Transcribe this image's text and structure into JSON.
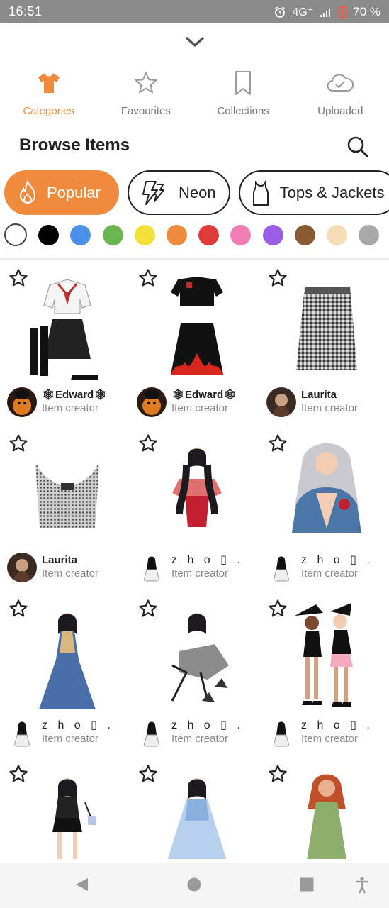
{
  "status": {
    "time": "16:51",
    "network": "4G⁺",
    "battery": "70 %"
  },
  "tabs": [
    {
      "label": "Categories",
      "icon": "tshirt-icon",
      "active": true
    },
    {
      "label": "Favourites",
      "icon": "star-icon",
      "active": false
    },
    {
      "label": "Collections",
      "icon": "bookmark-icon",
      "active": false
    },
    {
      "label": "Uploaded",
      "icon": "cloud-check-icon",
      "active": false
    }
  ],
  "browse": {
    "title": "Browse Items"
  },
  "chips": [
    {
      "label": "Popular",
      "icon": "fire-icon",
      "active": true
    },
    {
      "label": "Neon",
      "icon": "lightning-icon",
      "active": false
    },
    {
      "label": "Tops & Jackets",
      "icon": "tank-top-icon",
      "active": false
    }
  ],
  "colors": [
    "#ffffff",
    "#000000",
    "#4a8fe8",
    "#6ab550",
    "#f3e13a",
    "#f08a3c",
    "#e03c3c",
    "#f07eb4",
    "#9b5de5",
    "#8a5a32",
    "#f7dcb8",
    "#a8a8a8"
  ],
  "items": [
    {
      "creator": "🕸Edward🕸",
      "role": "Item creator",
      "thumb": "school-uniform"
    },
    {
      "creator": "🕸Edward🕸",
      "role": "Item creator",
      "thumb": "flame-outfit"
    },
    {
      "creator": "Laurita",
      "role": "Item creator",
      "thumb": "tweed-skirt"
    },
    {
      "creator": "Laurita",
      "role": "Item creator",
      "thumb": "chain-top"
    },
    {
      "creator": "z h o ▯ .",
      "role": "Item creator",
      "thumb": "girl-offshoulder"
    },
    {
      "creator": "z h o ▯ .",
      "role": "Item creator",
      "thumb": "girl-silver-hair"
    },
    {
      "creator": "z h o ▯ .",
      "role": "Item creator",
      "thumb": "gown-blue"
    },
    {
      "creator": "z h o ▯ .",
      "role": "Item creator",
      "thumb": "girl-pose"
    },
    {
      "creator": "z h o ▯ .",
      "role": "Item creator",
      "thumb": "witch-duo"
    },
    {
      "creator": "",
      "role": "",
      "thumb": "girl-bag"
    },
    {
      "creator": "",
      "role": "",
      "thumb": "girl-blue-dress"
    },
    {
      "creator": "",
      "role": "",
      "thumb": "girl-green-dress"
    }
  ]
}
